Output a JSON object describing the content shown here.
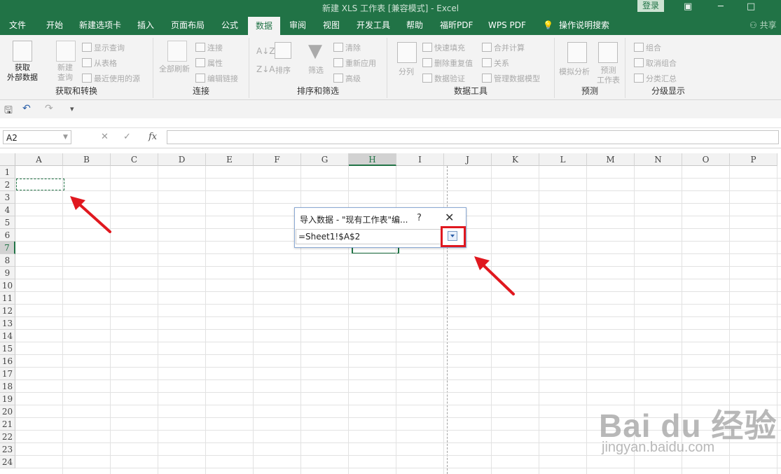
{
  "window": {
    "title": "新建 XLS 工作表 [兼容模式] - Excel",
    "login_label": "登录"
  },
  "tabs": [
    "文件",
    "开始",
    "新建选项卡",
    "插入",
    "页面布局",
    "公式",
    "数据",
    "审阅",
    "视图",
    "开发工具",
    "帮助",
    "福昕PDF",
    "WPS PDF",
    "操作说明搜索"
  ],
  "share_label": "共享",
  "ribbon": {
    "groups": {
      "get_transform": "获取和转换",
      "connections": "连接",
      "sort_filter": "排序和筛选",
      "data_tools": "数据工具",
      "forecast": "预测",
      "outline": "分级显示"
    },
    "get_external": "获取\n外部数据",
    "new_query": "新建\n查询",
    "show_queries": "显示查询",
    "from_table": "从表格",
    "recent_sources": "最近使用的源",
    "refresh_all": "全部刷新",
    "connections": "连接",
    "properties": "属性",
    "edit_links": "编辑链接",
    "sort": "排序",
    "filter": "筛选",
    "clear": "清除",
    "reapply": "重新应用",
    "advanced": "高级",
    "text_to_columns": "分列",
    "flash_fill": "快速填充",
    "remove_duplicates": "删除重复值",
    "data_validation": "数据验证",
    "consolidate": "合并计算",
    "relationships": "关系",
    "manage_model": "管理数据模型",
    "what_if": "模拟分析",
    "forecast_sheet": "预测\n工作表",
    "group": "组合",
    "ungroup": "取消组合",
    "subtotal": "分类汇总"
  },
  "namebox": "A2",
  "columns": [
    "A",
    "B",
    "C",
    "D",
    "E",
    "F",
    "G",
    "H",
    "I",
    "J",
    "K",
    "L",
    "M",
    "N",
    "O",
    "P"
  ],
  "selected_column": "H",
  "rows": [
    "1",
    "2",
    "3",
    "4",
    "5",
    "6",
    "7",
    "8",
    "9",
    "10",
    "11",
    "12",
    "13",
    "14",
    "15",
    "16",
    "17",
    "18",
    "19",
    "20",
    "21",
    "22",
    "23",
    "24"
  ],
  "selected_row": "7",
  "dialog": {
    "title": "导入数据 - \"现有工作表\"编...",
    "help": "?",
    "close": "✕",
    "value": "=Sheet1!$A$2"
  },
  "watermark": {
    "logo": "Bai du 经验",
    "url": "jingyan.baidu.com"
  },
  "colors": {
    "excel_green": "#217346",
    "highlight_red": "#e0181f"
  }
}
